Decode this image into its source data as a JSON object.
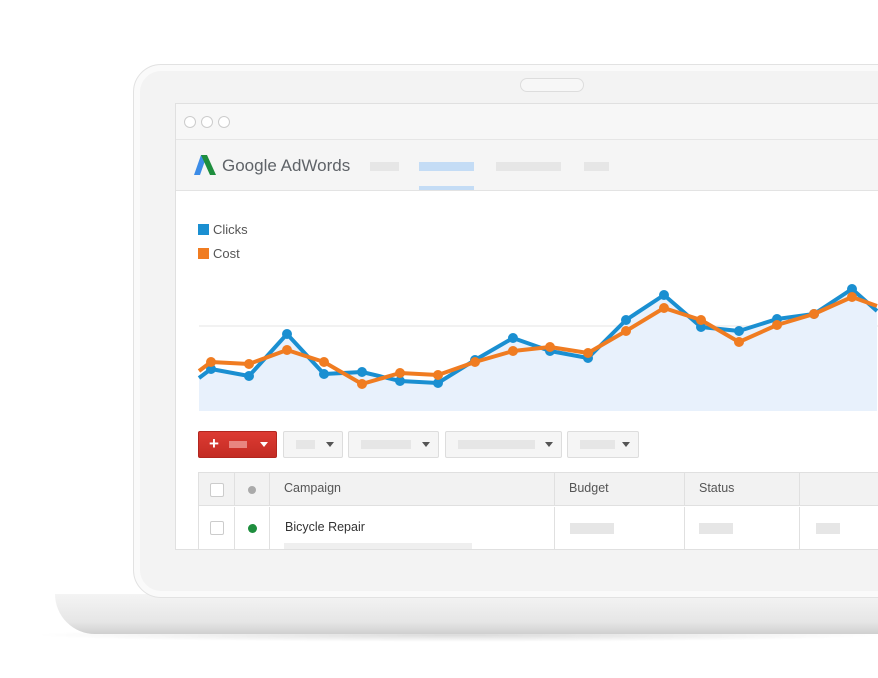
{
  "brand": {
    "name": "Google AdWords"
  },
  "chart_data": {
    "type": "line",
    "title": "",
    "xlabel": "",
    "ylabel": "",
    "grid": true,
    "legend_placement": "top-left",
    "area_fill_under": "Clicks",
    "series": [
      {
        "name": "Clicks",
        "color": "#1a8fd1",
        "values": [
          33,
          42,
          35,
          77,
          37,
          39,
          30,
          28,
          51,
          73,
          60,
          53,
          91,
          116,
          84,
          80,
          92,
          97,
          122,
          100
        ]
      },
      {
        "name": "Cost",
        "color": "#f07c21",
        "values": [
          40,
          49,
          47,
          61,
          49,
          27,
          38,
          36,
          49,
          60,
          64,
          58,
          80,
          103,
          91,
          69,
          86,
          97,
          114,
          105
        ]
      }
    ]
  },
  "toolbar": {
    "add_button_color": "#d0342c"
  },
  "table": {
    "headers": [
      "Campaign",
      "Budget",
      "Status"
    ],
    "rows": [
      {
        "campaign": "Bicycle Repair",
        "status_color": "#1e8e3e"
      }
    ]
  }
}
